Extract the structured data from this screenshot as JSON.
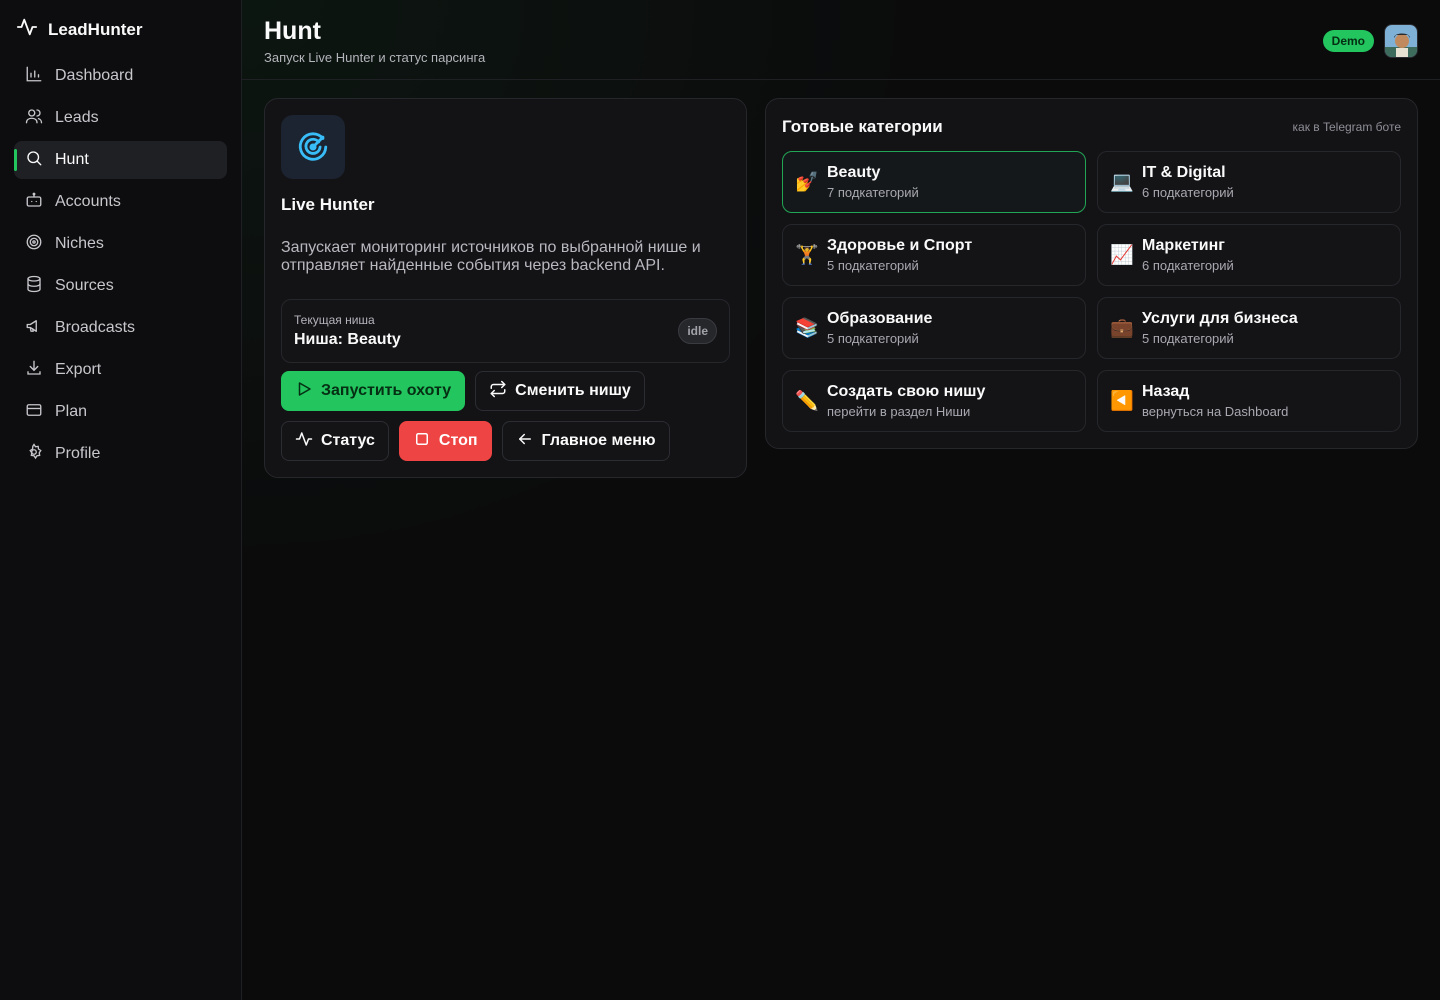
{
  "brand": {
    "name": "LeadHunter"
  },
  "sidebar": {
    "items": [
      {
        "label": "Dashboard",
        "icon": "bar-chart-icon"
      },
      {
        "label": "Leads",
        "icon": "users-icon"
      },
      {
        "label": "Hunt",
        "icon": "search-icon",
        "active": true
      },
      {
        "label": "Accounts",
        "icon": "bot-icon"
      },
      {
        "label": "Niches",
        "icon": "target-icon"
      },
      {
        "label": "Sources",
        "icon": "database-icon"
      },
      {
        "label": "Broadcasts",
        "icon": "megaphone-icon"
      },
      {
        "label": "Export",
        "icon": "download-icon"
      },
      {
        "label": "Plan",
        "icon": "credit-card-icon"
      },
      {
        "label": "Profile",
        "icon": "gear-icon"
      }
    ]
  },
  "header": {
    "title": "Hunt",
    "subtitle": "Запуск Live Hunter и статус парсинга",
    "badge": "Demo"
  },
  "hunter": {
    "title": "Live Hunter",
    "description": "Запускает мониторинг источников по выбранной нише и отправляет найденные события через backend API.",
    "niche_label": "Текущая ниша",
    "niche_value": "Ниша: Beauty",
    "status": "idle",
    "buttons": {
      "start": "Запустить охоту",
      "change": "Сменить нишу",
      "status": "Статус",
      "stop": "Стоп",
      "menu": "Главное меню"
    }
  },
  "categories": {
    "title": "Готовые категории",
    "note": "как в Telegram боте",
    "items": [
      {
        "emoji": "💅",
        "name": "Beauty",
        "sub": "7 подкатегорий",
        "selected": true
      },
      {
        "emoji": "💻",
        "name": "IT & Digital",
        "sub": "6 подкатегорий"
      },
      {
        "emoji": "🏋",
        "name": "Здоровье и Спорт",
        "sub": "5 подкатегорий"
      },
      {
        "emoji": "📈",
        "name": "Маркетинг",
        "sub": "6 подкатегорий"
      },
      {
        "emoji": "📚",
        "name": "Образование",
        "sub": "5 подкатегорий"
      },
      {
        "emoji": "💼",
        "name": "Услуги для бизнеса",
        "sub": "5 подкатегорий"
      },
      {
        "emoji": "✏️",
        "name": "Создать свою нишу",
        "sub": "перейти в раздел Ниши"
      },
      {
        "emoji": "◀️",
        "name": "Назад",
        "sub": "вернуться на Dashboard"
      }
    ]
  },
  "colors": {
    "accent": "#22c55e",
    "danger": "#ef4444",
    "background": "#0b0b0c"
  }
}
